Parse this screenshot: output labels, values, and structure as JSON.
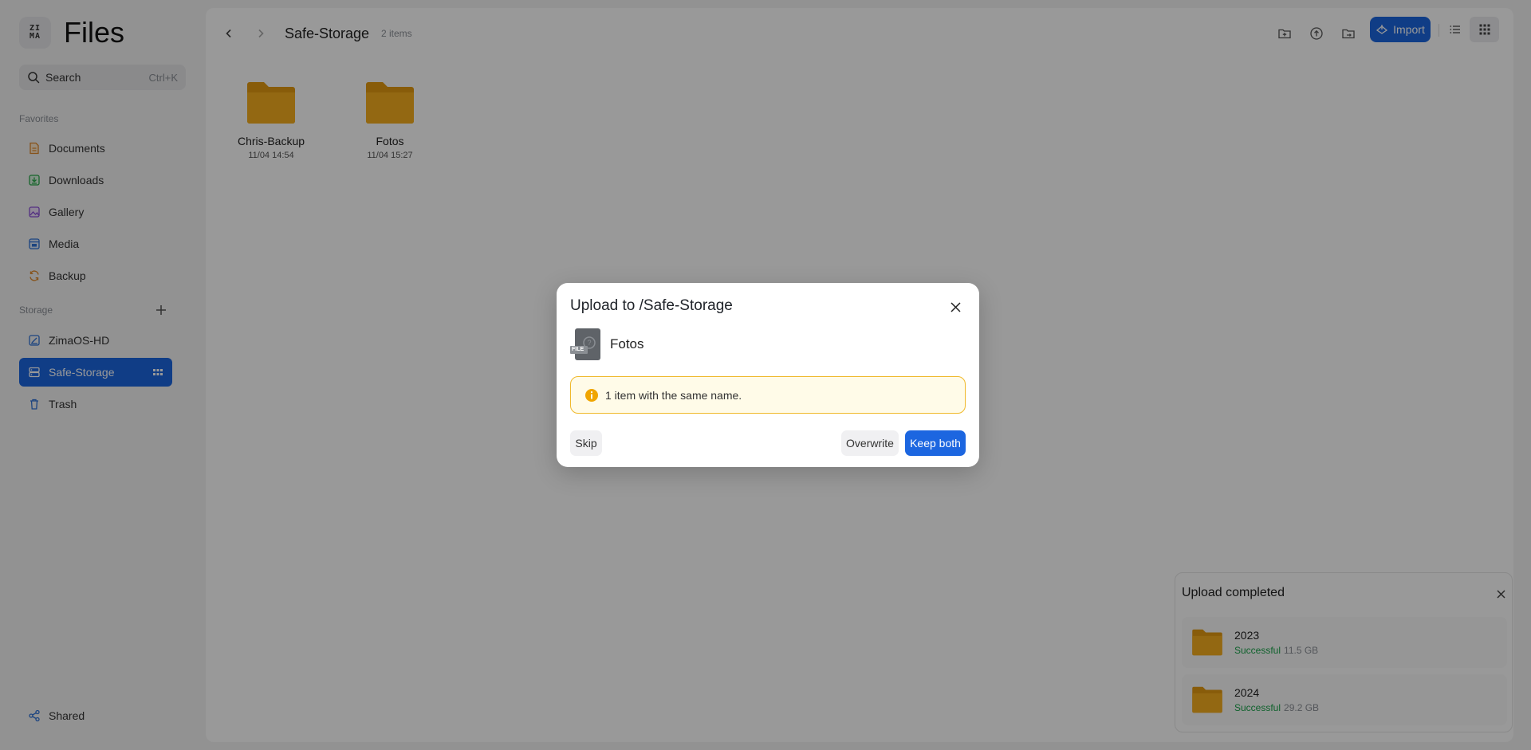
{
  "app": {
    "logo_text": "ZIMA",
    "title": "Files"
  },
  "search": {
    "label": "Search",
    "shortcut": "Ctrl+K"
  },
  "sidebar": {
    "favorites_label": "Favorites",
    "favorites": [
      {
        "label": "Documents",
        "icon": "documents-icon",
        "color": "#e0892b"
      },
      {
        "label": "Downloads",
        "icon": "downloads-icon",
        "color": "#2aa84a"
      },
      {
        "label": "Gallery",
        "icon": "gallery-icon",
        "color": "#8a4fd8"
      },
      {
        "label": "Media",
        "icon": "media-icon",
        "color": "#2f72d6"
      },
      {
        "label": "Backup",
        "icon": "backup-icon",
        "color": "#e0892b"
      }
    ],
    "storage_label": "Storage",
    "storage": [
      {
        "label": "ZimaOS-HD",
        "icon": "disk-icon"
      },
      {
        "label": "Safe-Storage",
        "icon": "storage-icon",
        "active": true
      },
      {
        "label": "Trash",
        "icon": "trash-icon"
      }
    ],
    "shared_label": "Shared"
  },
  "toolbar": {
    "breadcrumb": "Safe-Storage",
    "item_count": "2 items",
    "import_label": "Import",
    "accent": "#1c66e0"
  },
  "files": [
    {
      "name": "Chris-Backup",
      "date": "11/04 14:54"
    },
    {
      "name": "Fotos",
      "date": "11/04 15:27"
    }
  ],
  "upload_panel": {
    "title": "Upload completed",
    "items": [
      {
        "name": "2023",
        "status": "Successful",
        "size": "11.5 GB"
      },
      {
        "name": "2024",
        "status": "Successful",
        "size": "29.2 GB"
      }
    ]
  },
  "dialog": {
    "title": "Upload to /Safe-Storage",
    "file_name": "Fotos",
    "file_badge": "FILE",
    "warning": "1 item with the same name.",
    "skip_label": "Skip",
    "overwrite_label": "Overwrite",
    "keep_both_label": "Keep both"
  }
}
